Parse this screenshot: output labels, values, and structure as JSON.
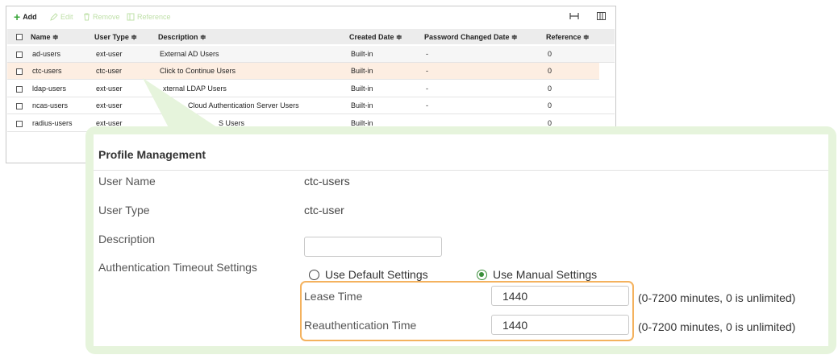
{
  "toolbar": {
    "add": "Add",
    "edit": "Edit",
    "remove": "Remove",
    "reference": "Reference"
  },
  "table": {
    "columns": [
      "Name",
      "User Type",
      "Description",
      "Created Date",
      "Password Changed Date",
      "Reference"
    ],
    "rows": [
      {
        "name": "ad-users",
        "type": "ext-user",
        "description": "External AD Users",
        "created": "Built-in",
        "pwd": "-",
        "ref": "0"
      },
      {
        "name": "ctc-users",
        "type": "ctc-user",
        "description": "Click to Continue Users",
        "created": "Built-in",
        "pwd": "-",
        "ref": "0"
      },
      {
        "name": "ldap-users",
        "type": "ext-user",
        "description": "xternal LDAP Users",
        "created": "Built-in",
        "pwd": "-",
        "ref": "0"
      },
      {
        "name": "ncas-users",
        "type": "ext-user",
        "description": "Cloud Authentication Server Users",
        "created": "Built-in",
        "pwd": "-",
        "ref": "0"
      },
      {
        "name": "radius-users",
        "type": "ext-user",
        "description": "S Users",
        "created": "Built-in",
        "pwd": "",
        "ref": "0"
      }
    ]
  },
  "profile": {
    "title": "Profile Management",
    "user_name_label": "User Name",
    "user_name_value": "ctc-users",
    "user_type_label": "User Type",
    "user_type_value": "ctc-user",
    "description_label": "Description",
    "description_value": "",
    "timeout_label": "Authentication Timeout Settings",
    "timeout_options": [
      "Use Default Settings",
      "Use Manual Settings"
    ],
    "timeout_selected": "Use Manual Settings",
    "lease_label": "Lease Time",
    "lease_value": "1440",
    "lease_hint": "(0-7200 minutes, 0 is unlimited)",
    "reauth_label": "Reauthentication Time",
    "reauth_value": "1440",
    "reauth_hint": "(0-7200 minutes, 0 is unlimited)"
  },
  "colors": {
    "accent_green": "#3a8f3a",
    "highlight_orange": "#f4b25e",
    "selected_row": "#fdeee2",
    "overlay_green": "#e6f4dc"
  }
}
